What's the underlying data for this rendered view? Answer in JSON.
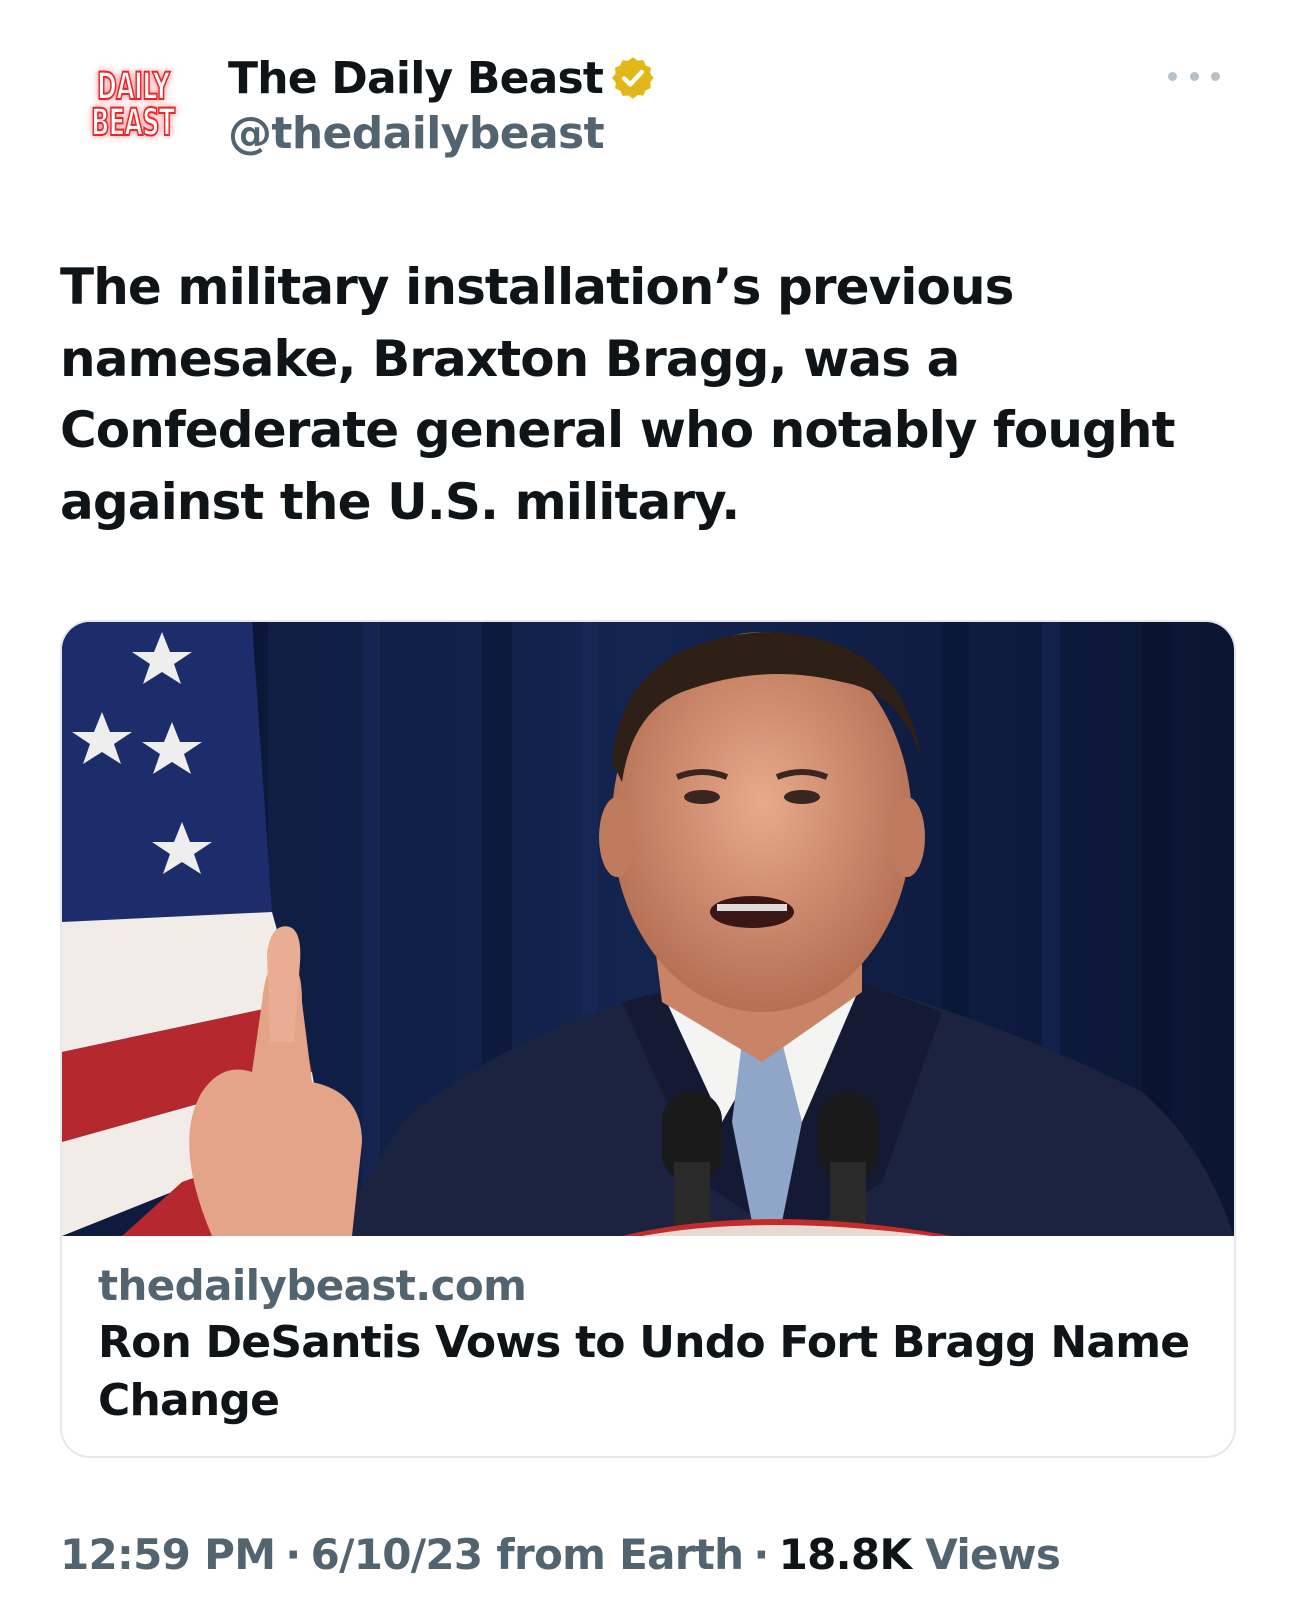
{
  "header": {
    "avatar_logo_line1": "DAILY",
    "avatar_logo_line2": "BEAST",
    "display_name": "The Daily Beast",
    "handle": "@thedailybeast",
    "verified_badge_color": "#e2b719",
    "more_icon": "more-horizontal-icon"
  },
  "tweet": {
    "text": "The military installation’s previous\nnamesake, Braxton Bragg, was a\nConfederate general who notably fought\nagainst the U.S. military."
  },
  "card": {
    "image_subject": "photo-of-speaker-at-podium-with-flag",
    "domain": "thedailybeast.com",
    "title": "Ron DeSantis Vows to Undo Fort Bragg Name Change"
  },
  "meta": {
    "time": "12:59 PM",
    "separator": "·",
    "date": "6/10/23",
    "source": "from Earth",
    "views_count": "18.8K",
    "views_label": "Views"
  },
  "colors": {
    "text_primary": "#0f1419",
    "text_secondary": "#536471",
    "brand_red": "#e8262b",
    "border": "#e3e8eb"
  }
}
